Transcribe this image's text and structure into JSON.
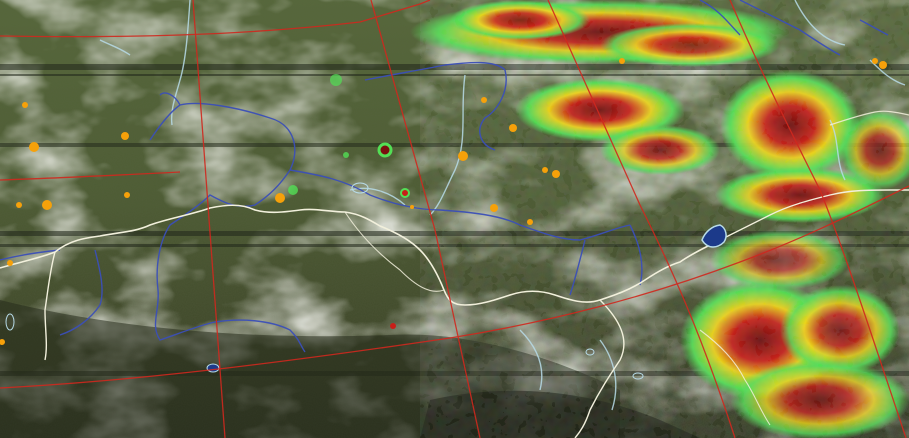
{
  "map": {
    "kind": "satellite-composite",
    "palette": {
      "terrain_green": "#5a6b3a",
      "terrain_dark": "#2e3520",
      "terrain_light": "#8f9a72",
      "cloud_white": "#cfd2c8",
      "graticule": "#d0281e",
      "border": "#f2f0dc",
      "admin_boundary": "#3b4fb8",
      "water": "#b7dbe8",
      "lake_fill": "#1c3a8a",
      "fire_marker": "#f6a10a",
      "precip_low": "#5fe35a",
      "precip_mid": "#f2e41a",
      "precip_high": "#e0241a",
      "precip_extreme": "#7a0f0f"
    }
  }
}
